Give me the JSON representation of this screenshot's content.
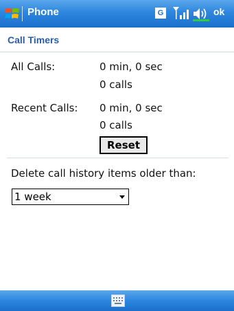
{
  "titlebar": {
    "title": "Phone",
    "network_badge": "G",
    "ok_label": "ok"
  },
  "header": {
    "title": "Call Timers"
  },
  "all_calls": {
    "label": "All Calls:",
    "time": "0 min, 0 sec",
    "count": "0 calls"
  },
  "recent_calls": {
    "label": "Recent Calls:",
    "time": "0 min, 0 sec",
    "count": "0 calls",
    "reset_label": "Reset"
  },
  "history": {
    "label": "Delete call history items older than:",
    "selected": "1 week"
  },
  "colors": {
    "titlebar": "#2d86dd",
    "header_text": "#2b5da6"
  },
  "icons": [
    "windows-start-icon",
    "signal-icon",
    "volume-icon",
    "keyboard-icon",
    "chevron-down-icon"
  ]
}
